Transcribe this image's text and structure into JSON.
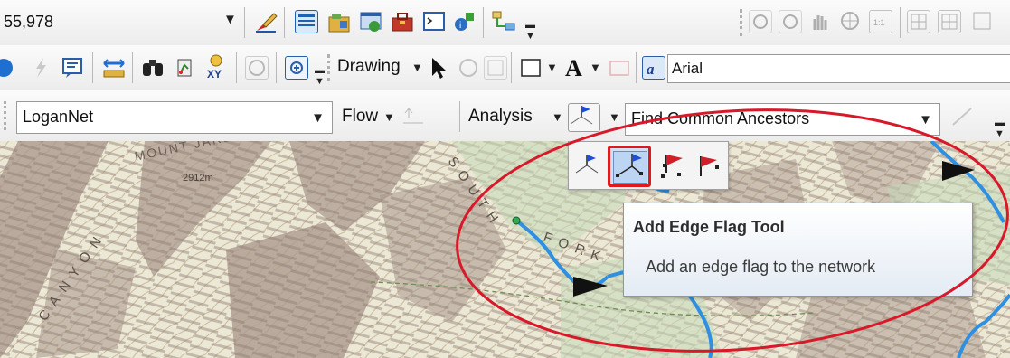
{
  "toolbar1": {
    "scale_value": "55,978",
    "icons": [
      "edit-icon",
      "attribute-table-icon",
      "catalog-icon",
      "search-window-icon",
      "arctoolbox-icon",
      "python-icon",
      "model-builder-icon",
      "help-icon"
    ]
  },
  "toolbar2": {
    "drawing_label": "Drawing",
    "font_value": "Arial"
  },
  "toolbar3": {
    "network_value": "LoganNet",
    "flow_label": "Flow",
    "analysis_label": "Analysis",
    "solver_value": "Find Common Ancestors"
  },
  "map": {
    "labels": {
      "jardine": "MOUNT JARDINE",
      "elevation": "2912m",
      "south": "SOUTH",
      "fork": "FORK",
      "canyon": "CANYON"
    }
  },
  "flag_menu": {
    "items": [
      "add-junction-flag-tool",
      "add-edge-flag-tool",
      "add-junction-barrier-tool",
      "add-edge-barrier-tool"
    ],
    "selected": "add-edge-flag-tool"
  },
  "tooltip": {
    "title": "Add Edge Flag Tool",
    "description": "Add an edge flag to the network"
  },
  "colors": {
    "highlight_ellipse": "#d7192a",
    "network_line": "#2f8fe0",
    "selection_border": "#e0191d"
  }
}
